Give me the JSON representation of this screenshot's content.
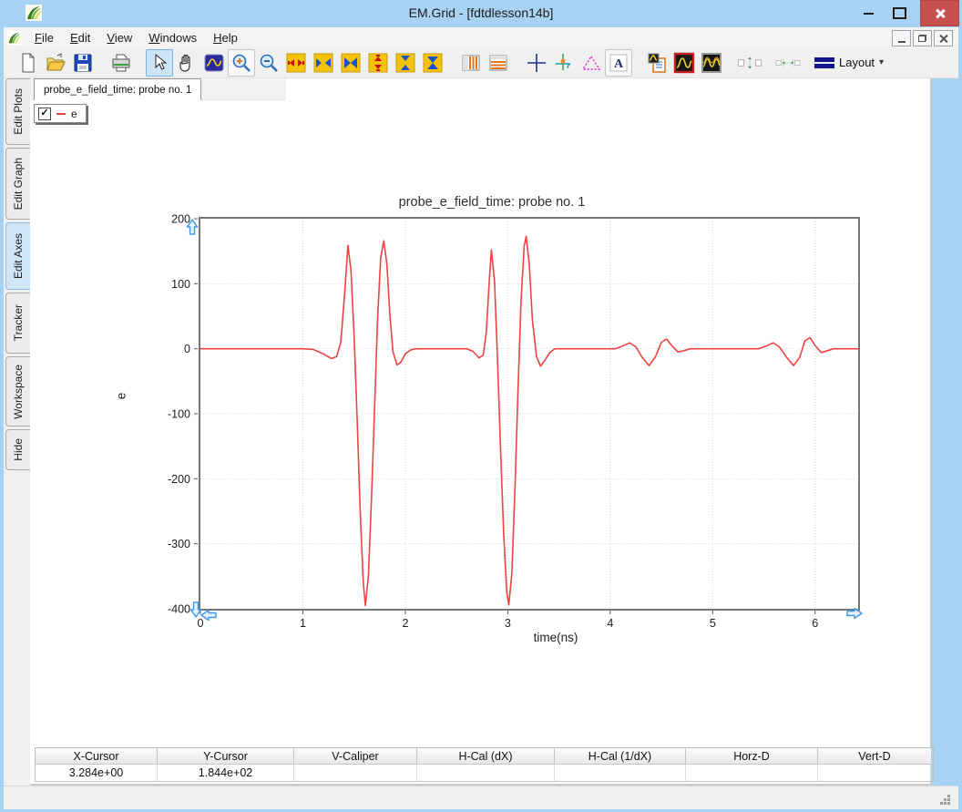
{
  "window": {
    "title": "EM.Grid - [fdtdlesson14b]"
  },
  "menu": {
    "items": [
      {
        "key": "F",
        "rest": "ile",
        "label": "File"
      },
      {
        "key": "E",
        "rest": "dit",
        "label": "Edit"
      },
      {
        "key": "V",
        "rest": "iew",
        "label": "View"
      },
      {
        "key": "W",
        "rest": "indows",
        "label": "Windows"
      },
      {
        "key": "H",
        "rest": "elp",
        "label": "Help"
      }
    ]
  },
  "toolbar": {
    "layout_label": "Layout",
    "layout_caret": "▾",
    "icons": [
      "new-file",
      "open-file",
      "save",
      "print",
      "select-pointer",
      "pan-hand",
      "zoom-region",
      "zoom-in",
      "zoom-out",
      "expand-x",
      "scale-x",
      "shrink-x",
      "expand-y",
      "scale-y",
      "shrink-y",
      "vertical-grid",
      "horizontal-grid",
      "crosshair",
      "tracker",
      "marker-triangle",
      "text-annotation",
      "plot-properties",
      "single-curve",
      "multi-curve",
      "fit-vertical",
      "fit-horizontal",
      "layout-menu"
    ]
  },
  "sidebar": {
    "items": [
      {
        "label": "Edit Plots",
        "selected": false
      },
      {
        "label": "Edit Graph",
        "selected": false
      },
      {
        "label": "Edit Axes",
        "selected": true
      },
      {
        "label": "Tracker",
        "selected": false
      },
      {
        "label": "Workspace",
        "selected": false
      },
      {
        "label": "Hide",
        "selected": false
      }
    ]
  },
  "doc_tab": {
    "label": "probe_e_field_time: probe no. 1"
  },
  "legend": {
    "checked": true,
    "checkmark": "✓",
    "series_label": "e",
    "series_color": "#ee4343"
  },
  "chart_data": {
    "type": "line",
    "title": "probe_e_field_time: probe no. 1",
    "xlabel": "time(ns)",
    "ylabel": "e",
    "xlim": [
      0,
      6.42
    ],
    "ylim": [
      -400,
      200
    ],
    "xticks": [
      0,
      1,
      2,
      3,
      4,
      5,
      6
    ],
    "yticks": [
      200,
      100,
      0,
      -100,
      -200,
      -300,
      -400
    ],
    "grid": true,
    "legend_position": "top-left-overlay",
    "series": [
      {
        "name": "e",
        "color": "#ee4343",
        "points": [
          [
            0,
            0
          ],
          [
            0.4,
            0
          ],
          [
            0.8,
            0
          ],
          [
            1.0,
            0
          ],
          [
            1.1,
            -1
          ],
          [
            1.2,
            -8
          ],
          [
            1.28,
            -15
          ],
          [
            1.33,
            -12
          ],
          [
            1.37,
            10
          ],
          [
            1.41,
            90
          ],
          [
            1.44,
            159
          ],
          [
            1.47,
            120
          ],
          [
            1.5,
            20
          ],
          [
            1.53,
            -110
          ],
          [
            1.56,
            -250
          ],
          [
            1.59,
            -360
          ],
          [
            1.61,
            -395
          ],
          [
            1.64,
            -350
          ],
          [
            1.67,
            -230
          ],
          [
            1.7,
            -90
          ],
          [
            1.73,
            50
          ],
          [
            1.76,
            140
          ],
          [
            1.79,
            166
          ],
          [
            1.82,
            130
          ],
          [
            1.85,
            50
          ],
          [
            1.88,
            -5
          ],
          [
            1.92,
            -25
          ],
          [
            1.96,
            -20
          ],
          [
            2.0,
            -8
          ],
          [
            2.05,
            -2
          ],
          [
            2.1,
            0
          ],
          [
            2.4,
            0
          ],
          [
            2.6,
            0
          ],
          [
            2.66,
            -4
          ],
          [
            2.72,
            -14
          ],
          [
            2.76,
            -10
          ],
          [
            2.79,
            25
          ],
          [
            2.82,
            105
          ],
          [
            2.84,
            152
          ],
          [
            2.87,
            105
          ],
          [
            2.9,
            -15
          ],
          [
            2.93,
            -155
          ],
          [
            2.96,
            -285
          ],
          [
            2.99,
            -375
          ],
          [
            3.01,
            -394
          ],
          [
            3.04,
            -345
          ],
          [
            3.07,
            -215
          ],
          [
            3.1,
            -65
          ],
          [
            3.13,
            75
          ],
          [
            3.16,
            158
          ],
          [
            3.18,
            173
          ],
          [
            3.21,
            130
          ],
          [
            3.24,
            45
          ],
          [
            3.28,
            -12
          ],
          [
            3.32,
            -27
          ],
          [
            3.36,
            -18
          ],
          [
            3.41,
            -6
          ],
          [
            3.46,
            0
          ],
          [
            3.8,
            0
          ],
          [
            4.05,
            0
          ],
          [
            4.12,
            4
          ],
          [
            4.19,
            9
          ],
          [
            4.25,
            3
          ],
          [
            4.31,
            -13
          ],
          [
            4.38,
            -26
          ],
          [
            4.44,
            -13
          ],
          [
            4.5,
            10
          ],
          [
            4.55,
            15
          ],
          [
            4.6,
            5
          ],
          [
            4.66,
            -5
          ],
          [
            4.72,
            -3
          ],
          [
            4.78,
            0
          ],
          [
            5.1,
            0
          ],
          [
            5.45,
            0
          ],
          [
            5.52,
            4
          ],
          [
            5.59,
            9
          ],
          [
            5.65,
            3
          ],
          [
            5.72,
            -13
          ],
          [
            5.79,
            -26
          ],
          [
            5.85,
            -13
          ],
          [
            5.9,
            12
          ],
          [
            5.95,
            17
          ],
          [
            6.0,
            5
          ],
          [
            6.06,
            -6
          ],
          [
            6.12,
            -3
          ],
          [
            6.18,
            0
          ],
          [
            6.42,
            0
          ]
        ]
      }
    ]
  },
  "cursor_table": {
    "headers": [
      "X-Cursor",
      "Y-Cursor",
      "V-Caliper",
      "H-Cal (dX)",
      "H-Cal (1/dX)",
      "Horz-D",
      "Vert-D"
    ],
    "values": [
      "3.284e+00",
      "1.844e+02",
      "",
      "",
      "",
      "",
      ""
    ]
  },
  "colors": {
    "titlebar": "#a8d2f2",
    "close_button": "#c75050",
    "selected_tab": "#cfe5f8",
    "toolbar_bg": "#f0f0f0",
    "plot_border": "#767676",
    "series_red": "#ee4343",
    "cursor_blue": "#3f97ea"
  }
}
